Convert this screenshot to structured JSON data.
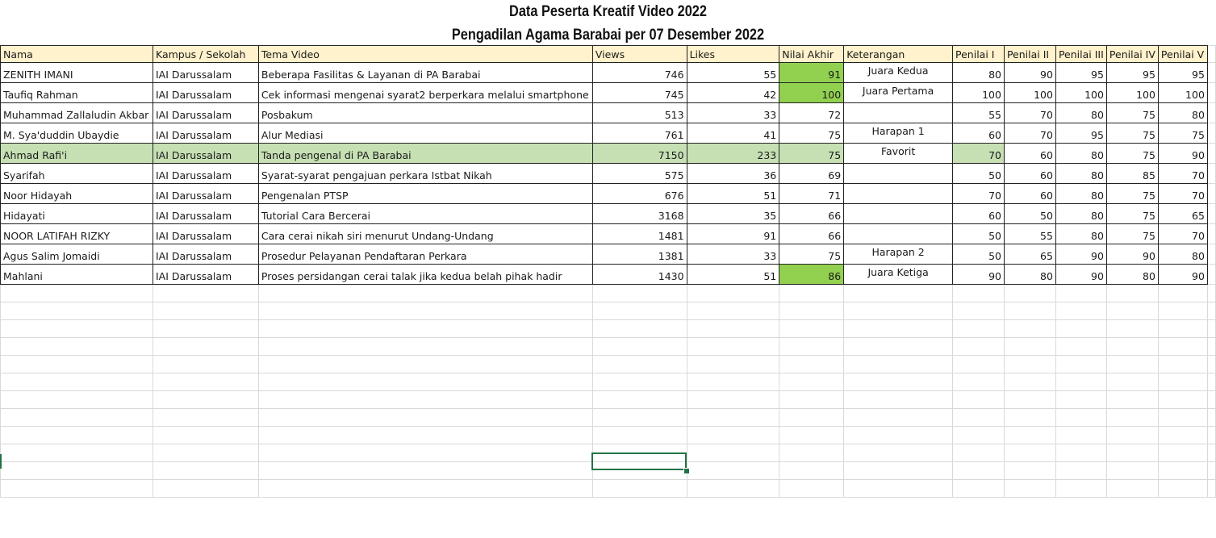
{
  "titles": {
    "line1": "Data Peserta Kreatif Video 2022",
    "line2": "Pengadilan Agama Barabai per 07 Desember 2022"
  },
  "headers": [
    "Nama",
    "Kampus / Sekolah",
    "Tema Video",
    "Views",
    "Likes",
    "Nilai Akhir",
    "Keterangan",
    "Penilai I",
    "Penilai II",
    "Penilai III",
    "Penilai IV",
    "Penilai V"
  ],
  "rows": [
    [
      "ZENITH IMANI",
      "IAI Darussalam",
      "Beberapa Fasilitas & Layanan di PA Barabai",
      "746",
      "55",
      "91",
      "Juara Kedua",
      "80",
      "90",
      "95",
      "95",
      "95"
    ],
    [
      "Taufiq Rahman",
      "IAI Darussalam",
      "Cek informasi mengenai syarat2 berperkara melalui smartphone",
      "745",
      "42",
      "100",
      "Juara Pertama",
      "100",
      "100",
      "100",
      "100",
      "100"
    ],
    [
      "Muhammad Zallaludin Akbar",
      "IAI Darussalam",
      "Posbakum",
      "513",
      "33",
      "72",
      "",
      "55",
      "70",
      "80",
      "75",
      "80"
    ],
    [
      "M. Sya'duddin Ubaydie",
      "IAI Darussalam",
      "Alur Mediasi",
      "761",
      "41",
      "75",
      "Harapan 1",
      "60",
      "70",
      "95",
      "75",
      "75"
    ],
    [
      "Ahmad Rafi'i",
      "IAI Darussalam",
      "Tanda pengenal di PA Barabai",
      "7150",
      "233",
      "75",
      "Favorit",
      "70",
      "60",
      "80",
      "75",
      "90"
    ],
    [
      "Syarifah",
      "IAI Darussalam",
      "Syarat-syarat pengajuan perkara Istbat Nikah",
      "575",
      "36",
      "69",
      "",
      "50",
      "60",
      "80",
      "85",
      "70"
    ],
    [
      "Noor Hidayah",
      "IAI Darussalam",
      "Pengenalan PTSP",
      "676",
      "51",
      "71",
      "",
      "70",
      "60",
      "80",
      "75",
      "70"
    ],
    [
      "Hidayati",
      "IAI Darussalam",
      "Tutorial Cara Bercerai",
      "3168",
      "35",
      "66",
      "",
      "60",
      "50",
      "80",
      "75",
      "65"
    ],
    [
      "NOOR LATIFAH RIZKY",
      "IAI Darussalam",
      "Cara cerai nikah siri menurut Undang-Undang",
      "1481",
      "91",
      "66",
      "",
      "50",
      "55",
      "80",
      "75",
      "70"
    ],
    [
      "Agus Salim Jomaidi",
      "IAI Darussalam",
      "Prosedur Pelayanan Pendaftaran Perkara",
      "1381",
      "33",
      "75",
      "Harapan 2",
      "50",
      "65",
      "90",
      "90",
      "80"
    ],
    [
      "Mahlani",
      "IAI Darussalam",
      "Proses persidangan cerai talak jika kedua belah pihak hadir",
      "1430",
      "51",
      "86",
      "Juara Ketiga",
      "90",
      "80",
      "90",
      "80",
      "90"
    ]
  ],
  "highlights": {
    "row_fill": "#c6e0b4",
    "winner_fill": "#92d050",
    "header_fill": "#fff2cc",
    "selection_color": "#217346"
  }
}
